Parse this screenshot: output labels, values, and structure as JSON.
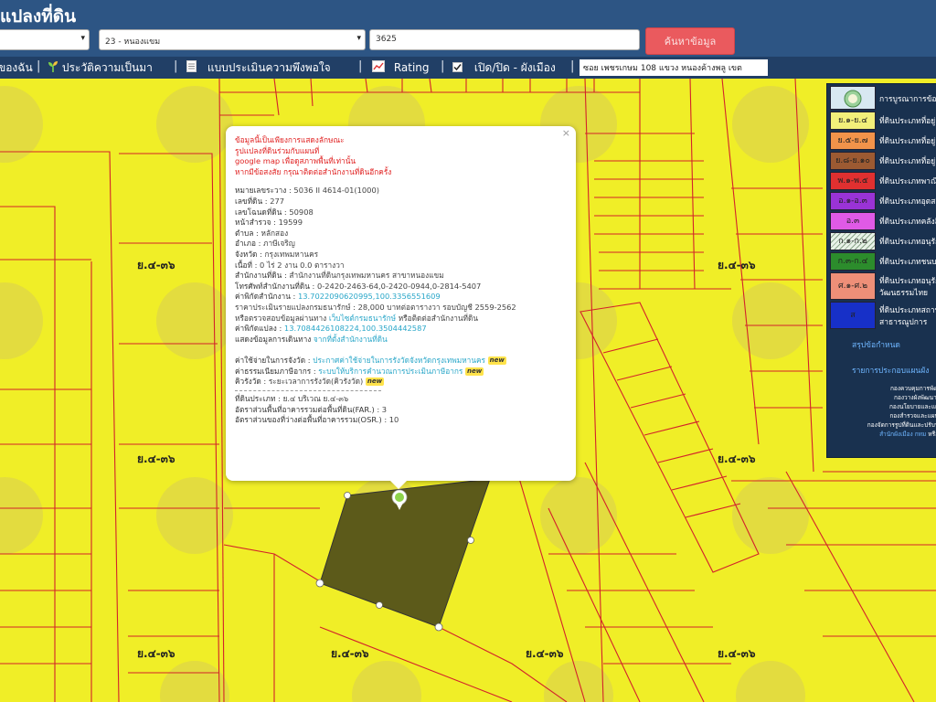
{
  "header": {
    "title": "แปลงที่ดิน"
  },
  "search": {
    "district": "",
    "subdistrict": "23 - หนองแขม",
    "parcel_number": "3625",
    "button": "ค้นหาข้อมูล"
  },
  "toolbar": {
    "item1": "ของฉัน",
    "item2": "ประวัติความเป็นมา",
    "item3": "แบบประเมินความพึงพอใจ",
    "item4": "Rating",
    "item5": "เปิด/ปิด - ผังเมือง",
    "address": "ซอย เพชรเกษม 108 แขวง หนองค้างพลู เขต"
  },
  "map": {
    "zone_label": "ย.๔-๓๖",
    "colors": {
      "yellow": "#f0ee27",
      "line": "#d3222a",
      "parcel": "#5c5a1a"
    }
  },
  "popup": {
    "warning": [
      "ข้อมูลนี้เป็นเพียงการแสดงลักษณะ",
      "รูปแปลงที่ดินร่วมกับแผนที่",
      "google map เพื่อดูสภาพพื้นที่เท่านั้น",
      "หากมีข้อสงสัย กรุณาติดต่อสำนักงานที่ดินอีกครั้ง"
    ],
    "survey_sheet_label": "หมายเลขระวาง",
    "survey_sheet": "5036 II 4614-01(1000)",
    "land_no_label": "เลขที่ดิน",
    "land_no": "277",
    "deed_no_label": "เลขโฉนดที่ดิน",
    "deed_no": "50908",
    "survey_page_label": "หน้าสำรวจ",
    "survey_page": "19599",
    "tambon_label": "ตำบล",
    "tambon": "หลักสอง",
    "amphoe_label": "อำเภอ",
    "amphoe": "ภาษีเจริญ",
    "province_label": "จังหวัด",
    "province": "กรุงเทพมหานคร",
    "area_label": "เนื้อที่",
    "area": "0 ไร่ 2 งาน 0.0 ตารางวา",
    "office_label": "สำนักงานที่ดิน",
    "office": "สำนักงานที่ดินกรุงเทพมหานคร สาขาหนองแขม",
    "phone_label": "โทรศัพท์สำนักงานที่ดิน",
    "phone": "0-2420-2463-64,0-2420-0944,0-2814-5407",
    "office_coord_label": "ค่าพิกัดสำนักงาน",
    "office_coord": "13.7022090620995,100.3356551609",
    "price_text": "ราคาประเมินรายแปลงกรมธนารักษ์ : 28,000 บาทต่อตารางวา รอบบัญชี 2559-2562",
    "check_prefix": "หรือตรวจสอบข้อมูลผ่านทาง",
    "check_link": "เว็บไซต์กรมธนารักษ์",
    "check_suffix": "หรือติดต่อสำนักงานที่ดิน",
    "parcel_coord_label": "ค่าพิกัดแปลง",
    "parcel_coord": "13.7084426108224,100.3504442587",
    "route_label": "แสดงข้อมูลการเดินทาง",
    "route_link": "จากที่ตั้งสำนักงานที่ดิน",
    "fee_label": "ค่าใช้จ่ายในการจังวัด",
    "fee_link": "ประกาศค่าใช้จ่ายในการรังวัดจังหวัดกรุงเทพมหานคร",
    "tax_label": "ค่าธรรมเนียมภาษีอากร",
    "tax_link": "ระบบให้บริการคำนวณการประเมินภาษีอากร",
    "queue_label": "คิวรังวัด",
    "queue_link": "ระยะเวลาการรังวัด(คิวรังวัด)",
    "new_badge": "new",
    "zone_type_label": "ที่ดินประเภท",
    "zone_type": "ย.๔ บริเวณ ย.๔-๓๖",
    "far_label": "อัตราส่วนพื้นที่อาคารรวมต่อพื้นที่ดิน(FAR.)",
    "far": "3",
    "osr_label": "อัตราส่วนของที่ว่างต่อพื้นที่อาคารรวม(OSR.)",
    "osr": "10",
    "close": "×"
  },
  "legend": {
    "header": "การบูรณาการข้อมูล",
    "items": [
      {
        "code": "ย.๑-ย.๔",
        "text": "ที่ดินประเภทที่อยู่อาศัย",
        "color": "#f2ef7a"
      },
      {
        "code": "ย.๕-ย.๗",
        "text": "ที่ดินประเภทที่อยู่อาศัย",
        "color": "#f2934a"
      },
      {
        "code": "ย.๘-ย.๑๐",
        "text": "ที่ดินประเภทที่อยู่อาศัย",
        "color": "#9c5a32"
      },
      {
        "code": "พ.๑-พ.๕",
        "text": "ที่ดินประเภทพาณิชย",
        "color": "#e03030"
      },
      {
        "code": "อ.๑-อ.๓",
        "text": "ที่ดินประเภทอุตสาหกรรม",
        "color": "#9a33d6"
      },
      {
        "code": "อ.๓",
        "text": "ที่ดินประเภทคลังสินค้า",
        "color": "#e05ae6"
      },
      {
        "code": "ก.๑-ก.๒",
        "text": "ที่ดินประเภทอนุรักษ์",
        "color": "#d6ead6"
      },
      {
        "code": "ก.๓-ก.๔",
        "text": "ที่ดินประเภทชนบท",
        "color": "#2c8c2c"
      },
      {
        "code": "ศ.๑-ศ.๒",
        "text": "ที่ดินประเภทอนุรักษ์",
        "text2": "วัฒนธรรมไทย",
        "color": "#ee8f78"
      },
      {
        "code": "ส",
        "text": "ที่ดินประเภทสถาบัน",
        "text2": "สาธารณูปการ",
        "color": "#1730c8"
      }
    ],
    "summary_link": "สรุปข้อกำหนด",
    "agency_link": "รายการประกอบแผนผัง",
    "agencies": [
      "กองควบคุมการพัฒ",
      "กองวางผังพัฒนาเ",
      "กองนโยบายและแผ",
      "กองสำรวจและแผน",
      "กองจัดการรูปที่ดินและปรับป"
    ],
    "footer_link": "สำนักผังเมือง กทม",
    "footer_or": "หรือ"
  }
}
